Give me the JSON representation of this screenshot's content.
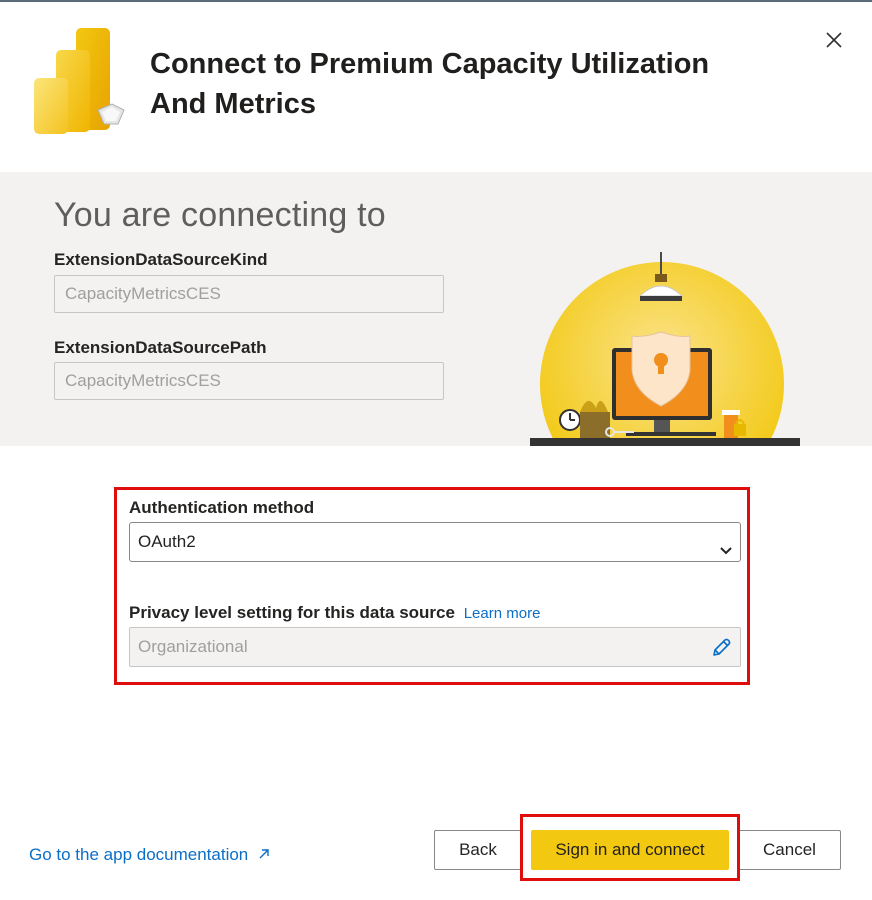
{
  "dialog": {
    "title": "Connect to Premium Capacity Utilization And Metrics",
    "logo_icon": "power-bi-logo-icon",
    "close_icon": "close-icon"
  },
  "connection": {
    "heading": "You are connecting to",
    "fields": [
      {
        "label": "ExtensionDataSourceKind",
        "value": "CapacityMetricsCES"
      },
      {
        "label": "ExtensionDataSourcePath",
        "value": "CapacityMetricsCES"
      }
    ]
  },
  "auth": {
    "label": "Authentication method",
    "selected": "OAuth2"
  },
  "privacy": {
    "label": "Privacy level setting for this data source",
    "learn_more": "Learn more",
    "value": "Organizational",
    "edit_icon": "pencil-icon"
  },
  "footer": {
    "doc_link": "Go to the app documentation",
    "doc_link_icon": "external-link-icon",
    "back": "Back",
    "sign_in": "Sign in and connect",
    "cancel": "Cancel"
  },
  "colors": {
    "accent": "#f2c811",
    "link": "#0b6ec7",
    "highlight": "#e00d0d",
    "band": "#f3f2f1"
  }
}
